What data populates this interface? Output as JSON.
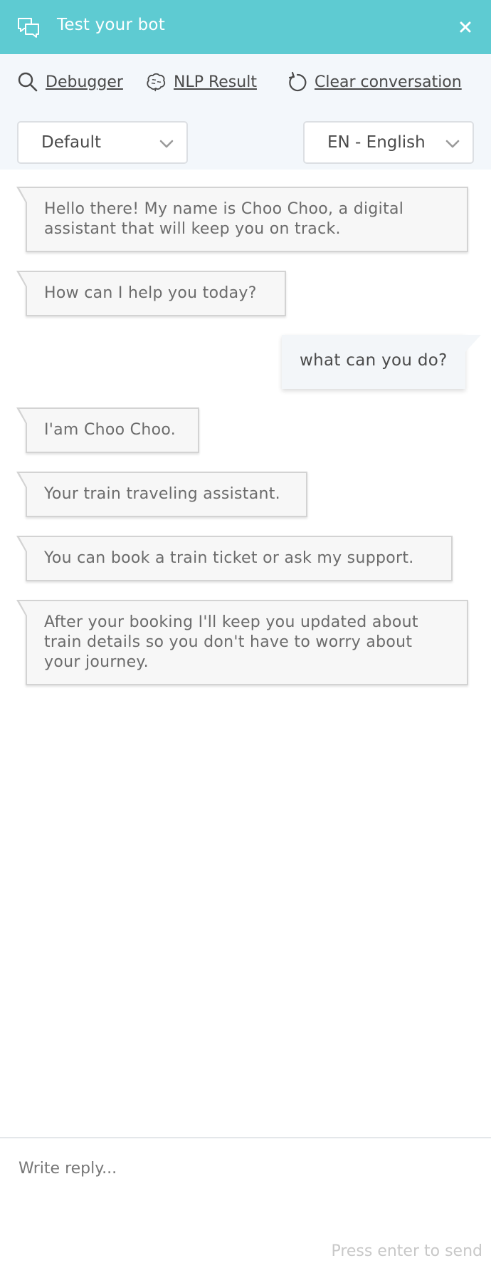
{
  "header": {
    "title": "Test your bot",
    "background": "#5ecbd2",
    "icons": {
      "chat": "chat-bubbles-icon",
      "close": "close-icon"
    }
  },
  "toolbar": {
    "debugger_label": "Debugger",
    "nlp_label": "NLP Result",
    "clear_label": "Clear conversation",
    "icons": {
      "debugger": "search-icon",
      "nlp": "brain-icon",
      "clear": "refresh-icon"
    }
  },
  "selectors": {
    "environment": "Default",
    "language": "EN - English"
  },
  "messages": [
    {
      "from": "bot",
      "text": "Hello there! My name is Choo Choo, a digital assistant that will keep you on track."
    },
    {
      "from": "bot",
      "text": "How can I help you today?"
    },
    {
      "from": "user",
      "text": "what can you do?"
    },
    {
      "from": "bot",
      "text": "I'am Choo Choo."
    },
    {
      "from": "bot",
      "text": "Your train traveling assistant."
    },
    {
      "from": "bot",
      "text": "You can book a train ticket or ask my support."
    },
    {
      "from": "bot",
      "text": "After your booking I'll keep you updated about train details so you don't have to worry about your journey."
    }
  ],
  "composer": {
    "placeholder": "Write reply...",
    "hint": "Press enter to send"
  }
}
